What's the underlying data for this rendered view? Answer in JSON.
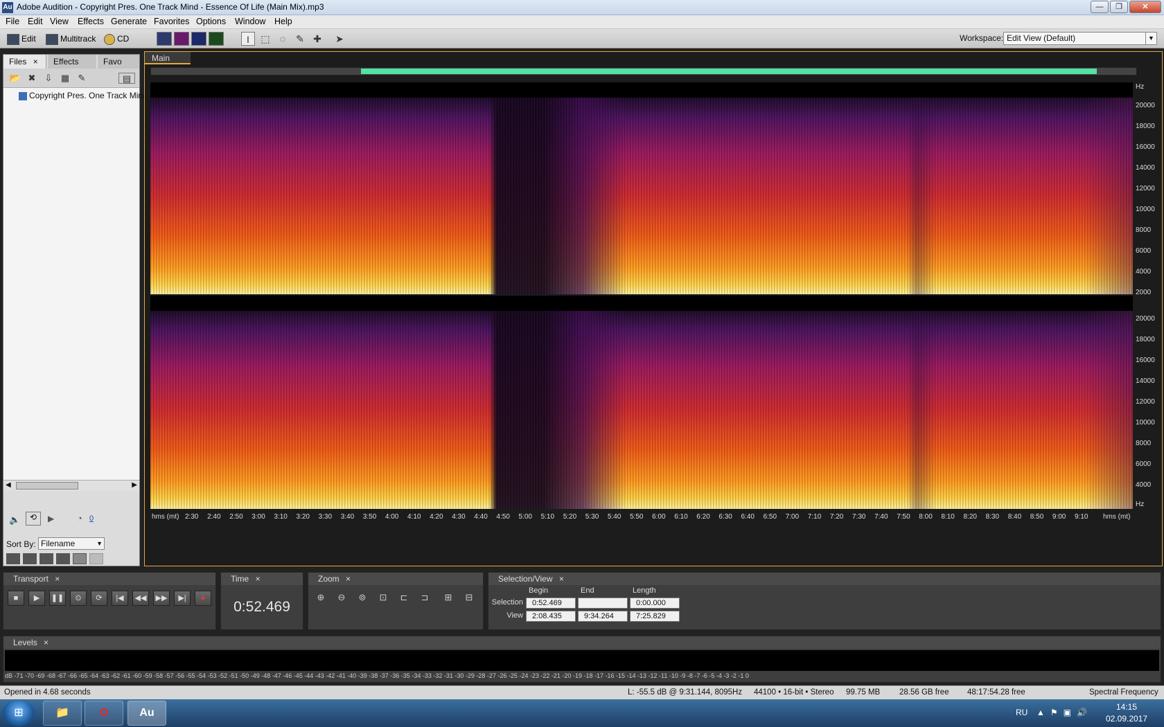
{
  "window": {
    "title": "Adobe Audition - Copyright Pres. One Track Mind - Essence Of Life (Main Mix).mp3",
    "app_icon_text": "Au",
    "minimize": "—",
    "maximize": "❐",
    "close": "✕"
  },
  "menu": [
    "File",
    "Edit",
    "View",
    "Effects",
    "Generate",
    "Favorites",
    "Options",
    "Window",
    "Help"
  ],
  "toolbar": {
    "modes": [
      "Edit",
      "Multitrack",
      "CD"
    ],
    "workspace_label": "Workspace:",
    "workspace_value": "Edit View (Default)"
  },
  "files_panel": {
    "tabs": [
      "Files",
      "Effects",
      "Favo"
    ],
    "file_name": "Copyright Pres. One Track Mind",
    "sort_label": "Sort By:",
    "sort_value": "Filename",
    "volume_value": "0"
  },
  "main_panel": {
    "tab": "Main",
    "hz_unit": "Hz",
    "hz_ticks": [
      "20000",
      "18000",
      "16000",
      "14000",
      "12000",
      "10000",
      "8000",
      "6000",
      "4000",
      "2000"
    ],
    "time_unit": "hms (mt)",
    "time_ticks": [
      "2:30",
      "2:40",
      "2:50",
      "3:00",
      "3:10",
      "3:20",
      "3:30",
      "3:40",
      "3:50",
      "4:00",
      "4:10",
      "4:20",
      "4:30",
      "4:40",
      "4:50",
      "5:00",
      "5:10",
      "5:20",
      "5:30",
      "5:40",
      "5:50",
      "6:00",
      "6:10",
      "6:20",
      "6:30",
      "6:40",
      "6:50",
      "7:00",
      "7:10",
      "7:20",
      "7:30",
      "7:40",
      "7:50",
      "8:00",
      "8:10",
      "8:20",
      "8:30",
      "8:40",
      "8:50",
      "9:00",
      "9:10"
    ]
  },
  "transport": {
    "title": "Transport"
  },
  "time_panel": {
    "title": "Time",
    "value": "0:52.469"
  },
  "zoom_panel": {
    "title": "Zoom"
  },
  "selection_view": {
    "title": "Selection/View",
    "col_begin": "Begin",
    "col_end": "End",
    "col_length": "Length",
    "row_selection": "Selection",
    "row_view": "View",
    "selection_begin": "0:52.469",
    "selection_end": "",
    "selection_length": "0:00.000",
    "view_begin": "2:08.435",
    "view_end": "9:34.264",
    "view_length": "7:25.829"
  },
  "levels": {
    "title": "Levels",
    "scale": "dB -71 -70 -69 -68 -67 -66 -65 -64 -63 -62 -61 -60 -59 -58 -57 -56 -55 -54 -53 -52 -51 -50 -49 -48 -47 -46 -45 -44 -43 -42 -41 -40 -39 -38 -37 -36 -35 -34 -33 -32 -31 -30 -29 -28 -27 -26 -25 -24 -23 -22 -21 -20 -19 -18 -17 -16 -15 -14 -13 -12 -11 -10 -9 -8 -7 -6 -5 -4 -3 -2 -1 0"
  },
  "status": {
    "opened": "Opened in 4.68 seconds",
    "cursor": "L: -55.5 dB @   9:31.144, 8095Hz",
    "format": "44100 • 16-bit • Stereo",
    "size": "99.75 MB",
    "free": "28.56 GB free",
    "time_free": "48:17:54.28 free",
    "display": "Spectral Frequency"
  },
  "taskbar": {
    "lang": "RU",
    "time": "14:15",
    "date": "02.09.2017",
    "audition_label": "Au"
  }
}
